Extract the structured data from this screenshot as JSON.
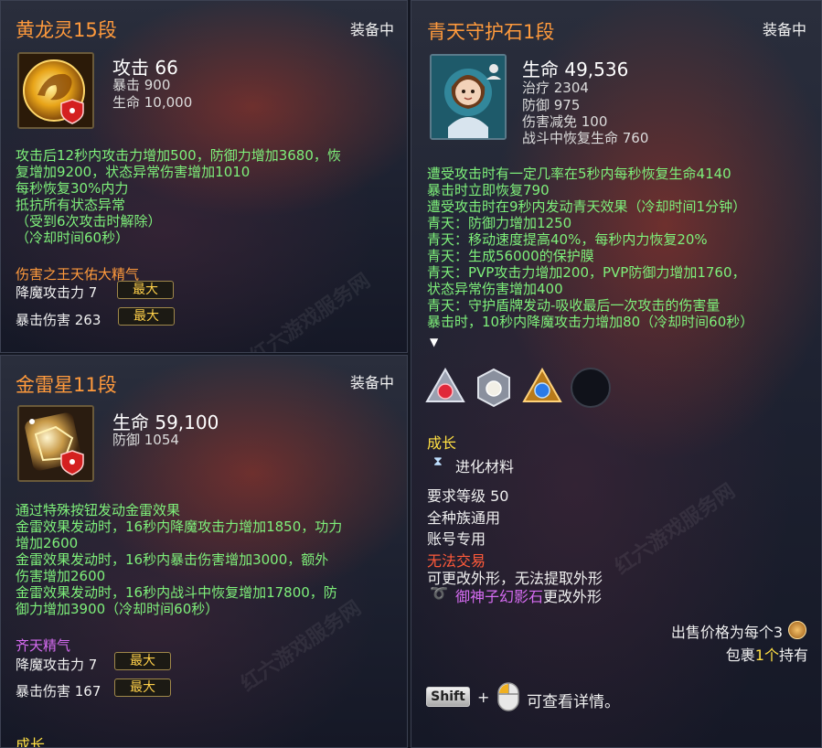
{
  "items": [
    {
      "title": "黄龙灵15段",
      "equipped": "装备中",
      "icon": "golden-dragon-soul-icon",
      "main_stat": "攻击 66",
      "sub_stats": [
        "暴击 900",
        "生命 10,000"
      ],
      "effects": [
        "攻击后12秒内攻击力增加500，防御力增加3680，恢",
        "复增加9200，状态异常伤害增加1010",
        "每秒恢复30%内力",
        "抵抗所有状态异常",
        "（受到6次攻击时解除）",
        "（冷却时间60秒）"
      ],
      "bonus_title": "伤害之王天佑大精气",
      "bonuses": [
        {
          "label": "降魔攻击力 7",
          "badge": "最大"
        },
        {
          "label": "暴击伤害 263",
          "badge": "最大"
        }
      ]
    },
    {
      "title": "金雷星11段",
      "equipped": "装备中",
      "icon": "golden-thunder-star-icon",
      "main_stat": "生命 59,100",
      "sub_stats": [
        "防御 1054"
      ],
      "effects": [
        "通过特殊按钮发动金雷效果",
        "金雷效果发动时，16秒内降魔攻击力增加1850，功力",
        "增加2600",
        "金雷效果发动时，16秒内暴击伤害增加3000，额外",
        "伤害增加2600",
        "金雷效果发动时，16秒内战斗中恢复增加17800，防",
        "御力增加3900（冷却时间60秒）"
      ],
      "bonus_title": "齐天精气",
      "bonuses": [
        {
          "label": "降魔攻击力 7",
          "badge": "最大"
        },
        {
          "label": "暴击伤害 167",
          "badge": "最大"
        }
      ],
      "growth_label": "成长"
    },
    {
      "title": "青天守护石1段",
      "equipped": "装备中",
      "icon": "sky-guardian-stone-icon",
      "main_stat": "生命 49,536",
      "sub_stats": [
        "治疗 2304",
        "防御 975",
        "伤害减免 100",
        "战斗中恢复生命 760"
      ],
      "effects": [
        "遭受攻击时有一定几率在5秒内每秒恢复生命4140",
        "暴击时立即恢复790",
        "遭受攻击时在9秒内发动青天效果（冷却时间1分钟）",
        "青天：防御力增加1250",
        "青天：移动速度提高40%，每秒内力恢复20%",
        "青天：生成56000的保护膜",
        "青天：PVP攻击力增加200，PVP防御力增加1760，",
        "状态异常伤害增加400",
        "青天：守护盾牌发动-吸收最后一次攻击的伤害量",
        "暴击时，10秒内降魔攻击力增加80（冷却时间60秒）"
      ],
      "growth_label": "成长",
      "growth_item": "进化材料",
      "req_level": "要求等级 50",
      "race": "全种族通用",
      "binding": "账号专用",
      "trade": "无法交易",
      "appearance": "可更改外形，无法提取外形",
      "appearance_stone": "御神子幻影石",
      "appearance_suffix": "更改外形",
      "price": "出售价格为每个3",
      "inventory_prefix": "包裹",
      "inventory_count": "1个",
      "inventory_suffix": "持有",
      "shift_key": "Shift",
      "plus": "+",
      "detail_hint": "可查看详情。"
    }
  ],
  "colors": {
    "title": "#ff9a3c",
    "effect": "#7ef07a",
    "bonus_title_orange": "#ff9a3c",
    "bonus_title_purple": "#d66cf2",
    "untradable": "#ff5a3a",
    "highlight": "#ffe043"
  },
  "gems": [
    "red-gem-icon",
    "white-pearl-gem-icon",
    "blue-gem-icon",
    "empty-gem-slot"
  ],
  "watermark": "红六游戏服务网"
}
